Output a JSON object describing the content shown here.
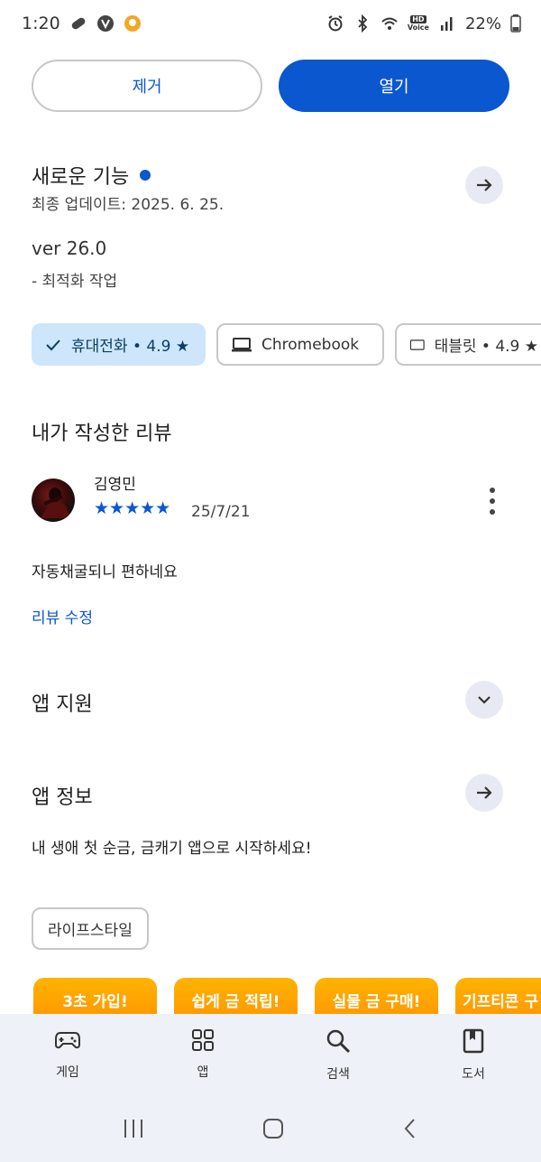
{
  "status_bar": {
    "time": "1:20",
    "battery": "22%",
    "hd_label": "HD",
    "voice_label": "Voice"
  },
  "actions": {
    "remove_label": "제거",
    "open_label": "열기"
  },
  "whats_new": {
    "title": "새로운 기능",
    "last_update": "최종 업데이트: 2025. 6. 25.",
    "version": "ver 26.0",
    "notes": "- 최적화 작업"
  },
  "device_chips": [
    {
      "label": "휴대전화 • 4.9 ★",
      "selected": true,
      "icon": "check-icon"
    },
    {
      "label": "Chromebook",
      "selected": false,
      "icon": "laptop-icon"
    },
    {
      "label": "태블릿 • 4.9 ★",
      "selected": false,
      "icon": "tablet-icon"
    }
  ],
  "my_review": {
    "section_title": "내가 작성한 리뷰",
    "reviewer_name": "김영민",
    "stars": "★★★★★",
    "date": "25/7/21",
    "text": "자동채굴되니 편하네요",
    "edit_label": "리뷰 수정"
  },
  "app_support": {
    "title": "앱 지원"
  },
  "app_info": {
    "title": "앱 정보",
    "description": "내 생애 첫 순금, 금캐기 앱으로 시작하세요!",
    "tag": "라이프스타일"
  },
  "promos": [
    {
      "label": "3초 가입!"
    },
    {
      "label": "쉽게 금 적립!"
    },
    {
      "label": "실물 금 구매!"
    },
    {
      "label": "기프티콘 구"
    }
  ],
  "bottom_nav": [
    {
      "label": "게임",
      "icon": "gamepad-icon"
    },
    {
      "label": "앱",
      "icon": "apps-grid-icon"
    },
    {
      "label": "검색",
      "icon": "search-icon"
    },
    {
      "label": "도서",
      "icon": "book-icon"
    }
  ],
  "colors": {
    "accent": "#0b57d0",
    "chip_selected": "#cde6fb",
    "nav_bg": "#eef1f7",
    "promo": "#ffa000"
  }
}
